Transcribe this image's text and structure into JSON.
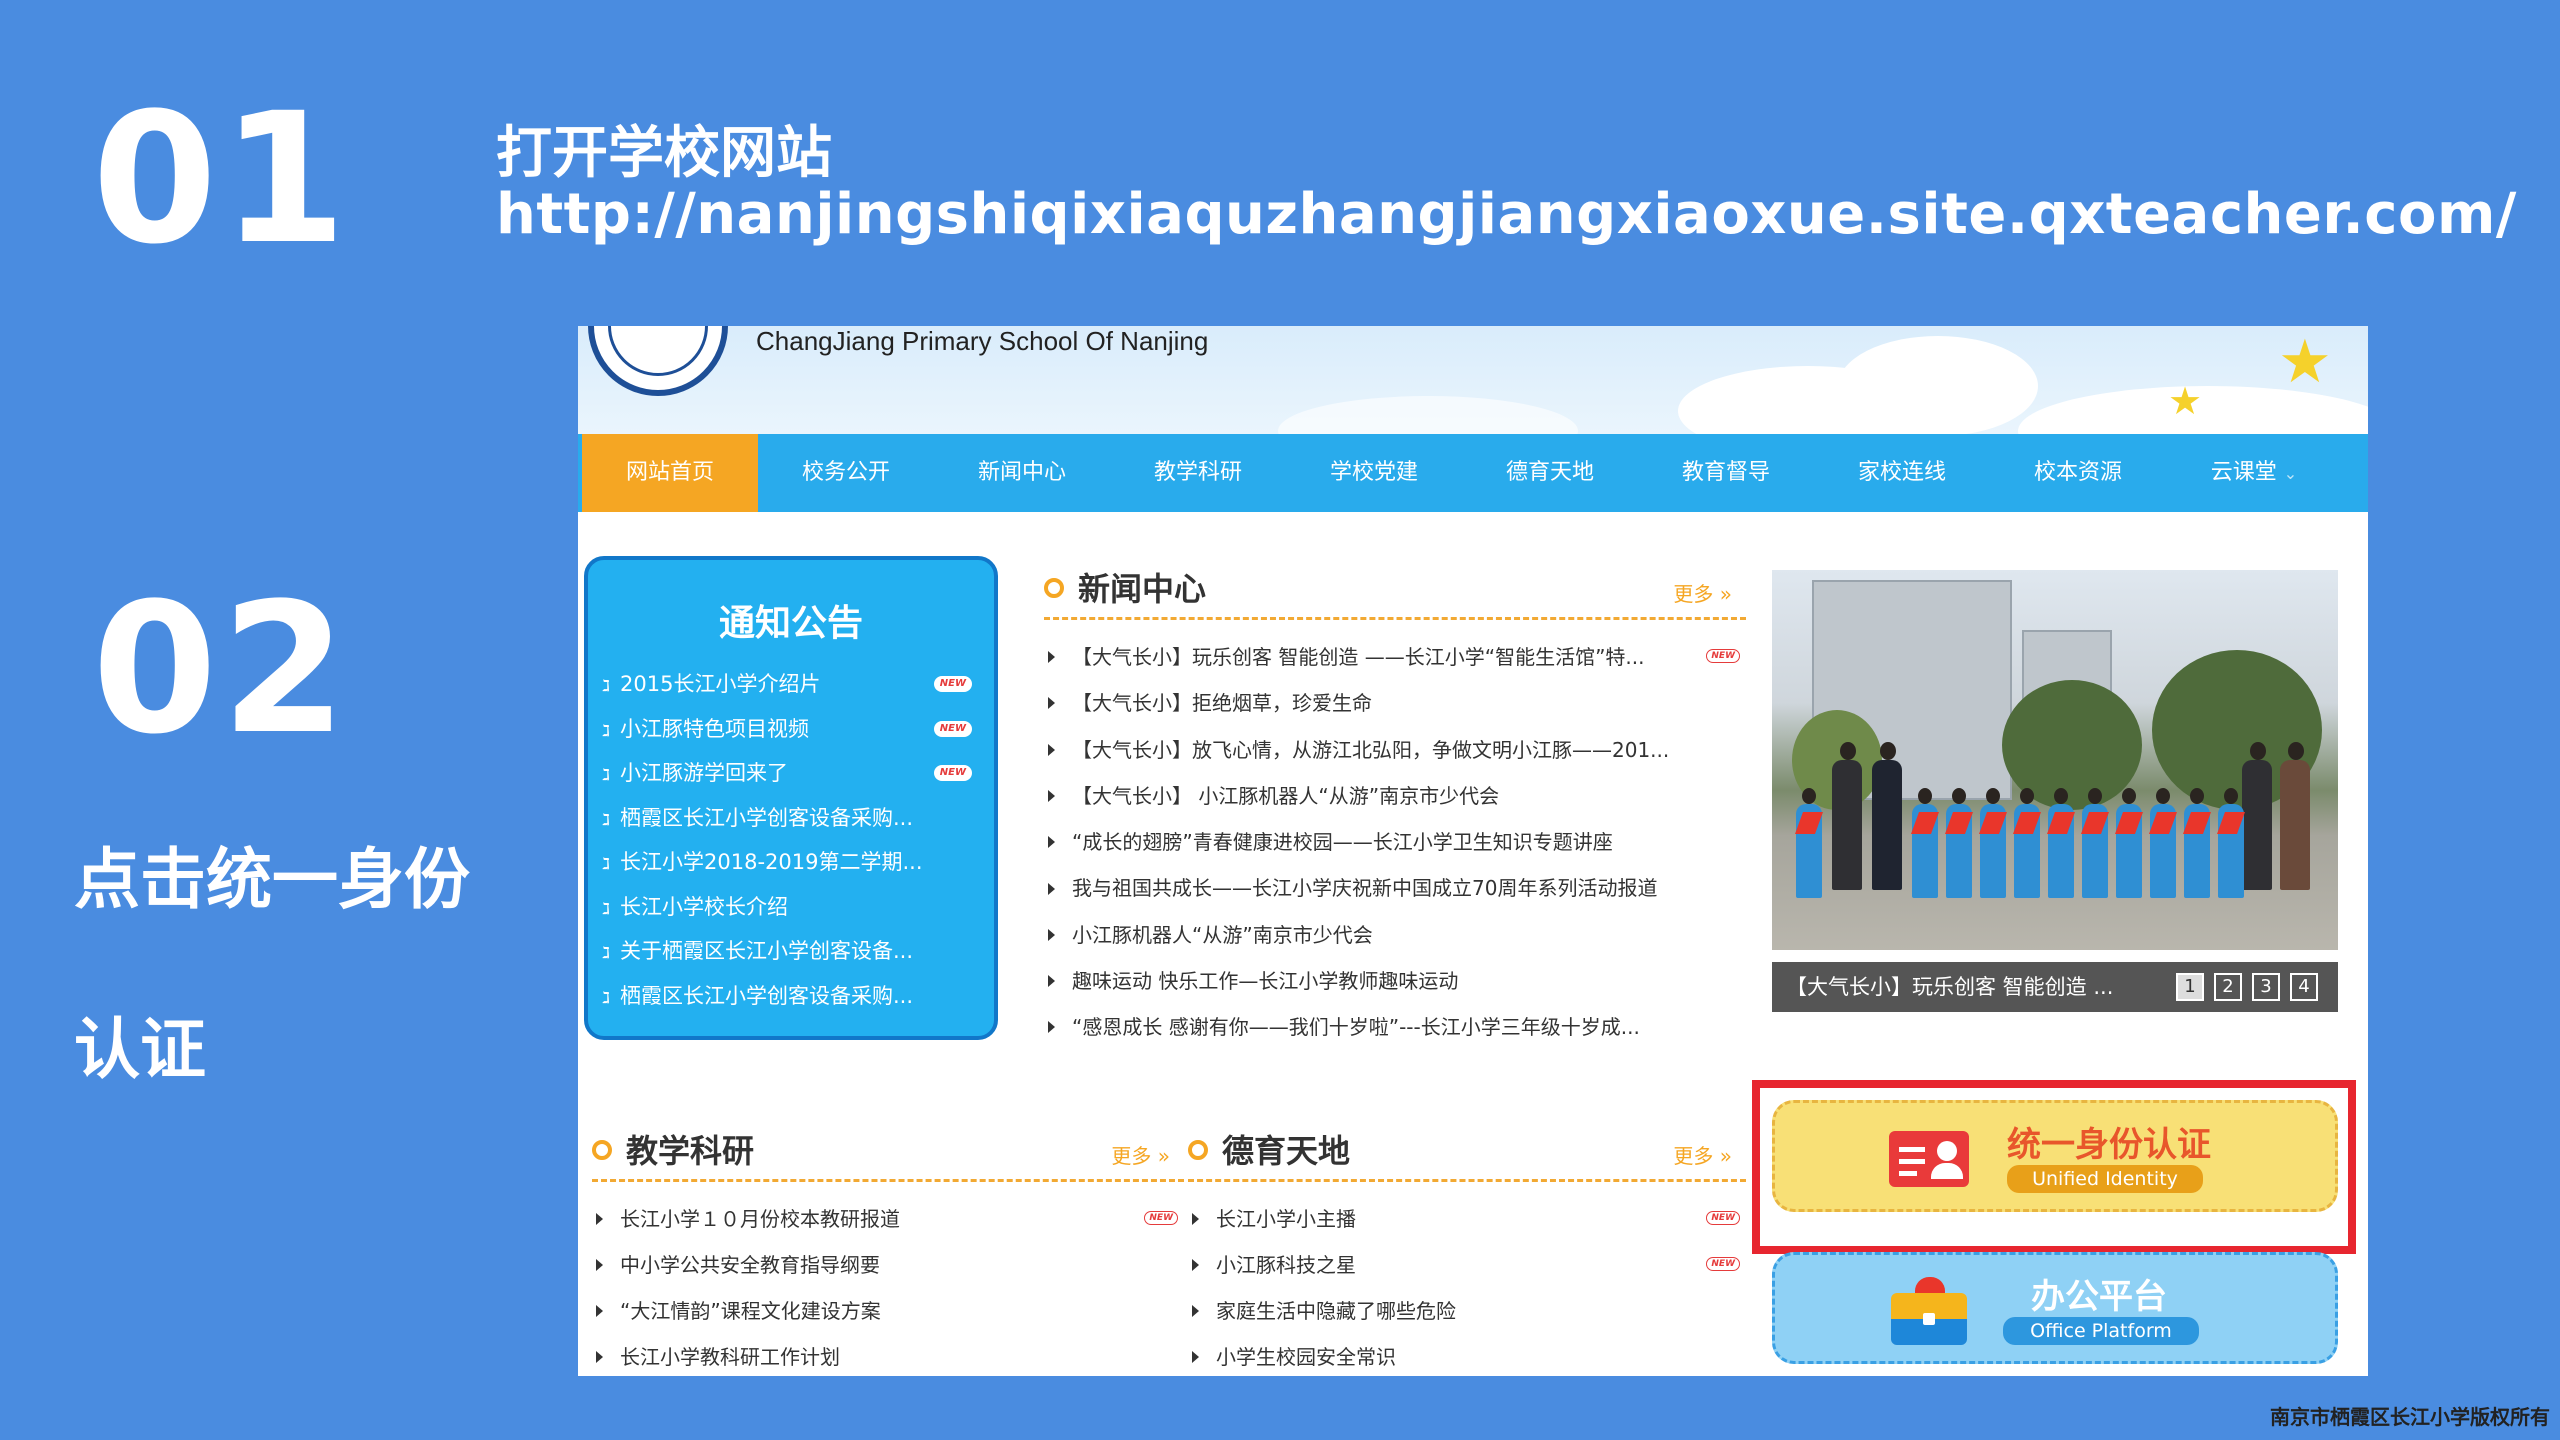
{
  "slide": {
    "step1_number": "01",
    "step1_title": "打开学校网站",
    "step1_url": "http://nanjingshiqixiaquzhangjiangxiaoxue.site.qxteacher.com/",
    "step2_number": "02",
    "step2_line1": "点击统一身份",
    "step2_line2": "认证",
    "copyright": "南京市栖霞区长江小学版权所有"
  },
  "site": {
    "school_name": "ChangJiang Primary School Of Nanjing",
    "nav": [
      "网站首页",
      "校务公开",
      "新闻中心",
      "教学科研",
      "学校党建",
      "德育天地",
      "教育督导",
      "家校连线",
      "校本资源",
      "云课堂"
    ],
    "nav_dropdown_glyph": "⌄",
    "notice": {
      "title": "通知公告",
      "new_label": "NEW",
      "items": [
        {
          "text": "2015长江小学介绍片",
          "is_new": true
        },
        {
          "text": "小江豚特色项目视频",
          "is_new": true
        },
        {
          "text": "小江豚游学回来了",
          "is_new": true
        },
        {
          "text": "栖霞区长江小学创客设备采购...",
          "is_new": false
        },
        {
          "text": "长江小学2018-2019第二学期...",
          "is_new": false
        },
        {
          "text": "长江小学校长介绍",
          "is_new": false
        },
        {
          "text": "关于栖霞区长江小学创客设备...",
          "is_new": false
        },
        {
          "text": "栖霞区长江小学创客设备采购...",
          "is_new": false
        }
      ]
    },
    "news": {
      "title": "新闻中心",
      "more": "更多 »",
      "items": [
        "【大气长小】玩乐创客 智能创造 ——长江小学“智能生活馆”特...",
        "【大气长小】拒绝烟草，珍爱生命",
        "【大气长小】放飞心情，从游江北弘阳，争做文明小江豚——201...",
        "【大气长小】 小江豚机器人“从游”南京市少代会",
        "“成长的翅膀”青春健康进校园——长江小学卫生知识专题讲座",
        "我与祖国共成长——长江小学庆祝新中国成立70周年系列活动报道",
        "小江豚机器人“从游”南京市少代会",
        "趣味运动 快乐工作—长江小学教师趣味运动",
        "“感恩成长 感谢有你——我们十岁啦”---长江小学三年级十岁成..."
      ]
    },
    "slideshow": {
      "caption": "【大气长小】玩乐创客 智能创造 ...",
      "pages": [
        "1",
        "2",
        "3",
        "4"
      ]
    },
    "teaching": {
      "title": "教学科研",
      "more": "更多 »",
      "items": [
        "长江小学１０月份校本教研报道",
        "中小学公共安全教育指导纲要",
        "“大江情韵”课程文化建设方案",
        "长江小学教科研工作计划"
      ]
    },
    "moral": {
      "title": "德育天地",
      "more": "更多 »",
      "items": [
        "长江小学小主播",
        "小江豚科技之星",
        "家庭生活中隐藏了哪些危险",
        "小学生校园安全常识"
      ]
    },
    "identity_button": {
      "title": "统一身份认证",
      "subtitle": "Unified Identity"
    },
    "office_button": {
      "title": "办公平台",
      "subtitle": "Office Platform"
    },
    "colors": {
      "slide_bg": "#4a8ce0",
      "nav_bg": "#29abec",
      "nav_active": "#f5a623",
      "highlight_frame": "#e7262f"
    }
  }
}
